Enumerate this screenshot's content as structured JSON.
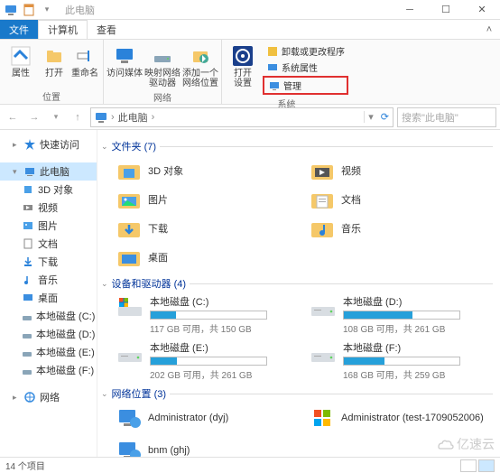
{
  "title": "此电脑",
  "tabs": {
    "file": "文件",
    "computer": "计算机",
    "view": "查看"
  },
  "ribbon": {
    "group1": {
      "label": "位置",
      "items": [
        "属性",
        "打开",
        "重命名"
      ]
    },
    "group2": {
      "label": "网络",
      "items": [
        "访问媒体",
        "映射网络\n驱动器",
        "添加一个\n网络位置"
      ]
    },
    "group3": {
      "label": "系统",
      "open_settings_l1": "打开",
      "open_settings_l2": "设置",
      "small": [
        "卸载或更改程序",
        "系统属性",
        "管理"
      ]
    }
  },
  "address": {
    "root": "此电脑"
  },
  "search_placeholder": "搜索\"此电脑\"",
  "nav": {
    "quick": "快速访问",
    "thispc": "此电脑",
    "sub": [
      "3D 对象",
      "视频",
      "图片",
      "文档",
      "下载",
      "音乐",
      "桌面",
      "本地磁盘 (C:)",
      "本地磁盘 (D:)",
      "本地磁盘 (E:)",
      "本地磁盘 (F:)"
    ],
    "network": "网络"
  },
  "folders_header": "文件夹 (7)",
  "folders": [
    "3D 对象",
    "视频",
    "图片",
    "文档",
    "下载",
    "音乐",
    "桌面"
  ],
  "drives_header": "设备和驱动器 (4)",
  "drives": [
    {
      "name": "本地磁盘 (C:)",
      "sub": "117 GB 可用，共 150 GB",
      "fill": 22
    },
    {
      "name": "本地磁盘 (D:)",
      "sub": "108 GB 可用，共 261 GB",
      "fill": 59
    },
    {
      "name": "本地磁盘 (E:)",
      "sub": "202 GB 可用，共 261 GB",
      "fill": 23
    },
    {
      "name": "本地磁盘 (F:)",
      "sub": "168 GB 可用，共 259 GB",
      "fill": 35
    }
  ],
  "netloc_header": "网络位置 (3)",
  "netloc": [
    "Administrator (dyj)",
    "Administrator (test-1709052006)",
    "bnm (ghj)"
  ],
  "status": "14 个项目",
  "watermark": "亿速云"
}
